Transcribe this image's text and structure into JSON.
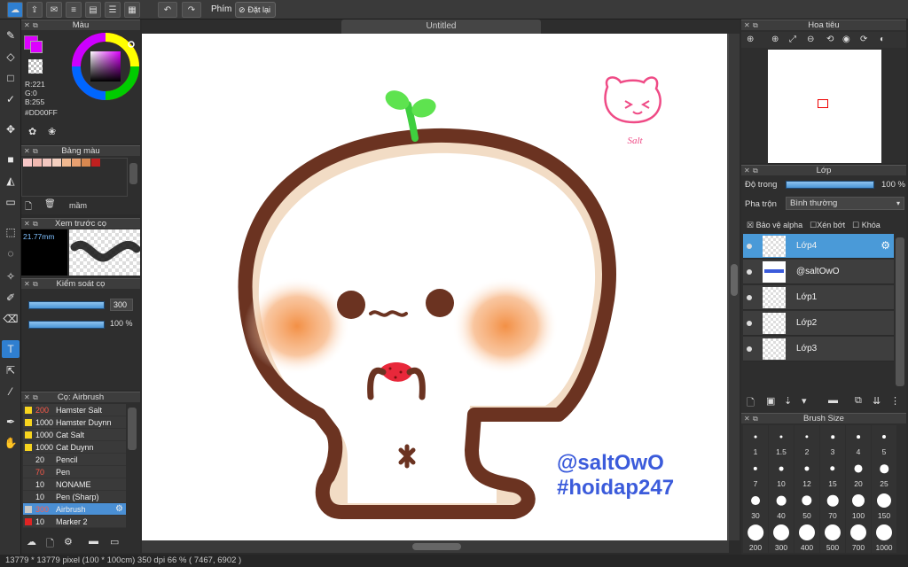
{
  "toolbar": {
    "shortcuts_label": "Phím",
    "reset_label": "Đặt lại"
  },
  "document": {
    "tab_title": "Untitled"
  },
  "color_panel": {
    "title": "Màu",
    "r": "R:221",
    "g": "G:0",
    "b": "B:255",
    "hex": "#DD00FF",
    "main_color": "#DD00FF"
  },
  "palette_panel": {
    "title": "Bảng màu",
    "swatches": [
      "#f6c6c6",
      "#f0b8b0",
      "#f3c7c0",
      "#f5d0c0",
      "#f0b890",
      "#e9a070",
      "#d98850",
      "#c0201f"
    ],
    "name_label": "mầm"
  },
  "preview_panel": {
    "title": "Xem trước cọ",
    "size_readout": "21.77mm"
  },
  "brush_control_panel": {
    "title": "Kiểm soát cọ",
    "size_value": "300",
    "opacity_value": "100 %"
  },
  "brush_list_panel": {
    "title": "Cọ: Airbrush",
    "items": [
      {
        "size": "200",
        "name": "Hamster Salt",
        "color": "#f7d41e",
        "size_red": true
      },
      {
        "size": "1000",
        "name": "Hamster Duynn",
        "color": "#f7d41e",
        "size_red": false
      },
      {
        "size": "1000",
        "name": "Cat Salt",
        "color": "#f7d41e",
        "size_red": false
      },
      {
        "size": "1000",
        "name": "Cat Duynn",
        "color": "#f7d41e",
        "size_red": false
      },
      {
        "size": "20",
        "name": "Pencil",
        "color": "#3a3a3a",
        "size_red": false
      },
      {
        "size": "70",
        "name": "Pen",
        "color": "#3a3a3a",
        "size_red": true
      },
      {
        "size": "10",
        "name": "NONAME",
        "color": "#3a3a3a",
        "size_red": false
      },
      {
        "size": "10",
        "name": "Pen (Sharp)",
        "color": "#3a3a3a",
        "size_red": false
      },
      {
        "size": "300",
        "name": "Airbrush",
        "color": "#c8c8c8",
        "size_red": true
      },
      {
        "size": "10",
        "name": "Marker 2",
        "color": "#e02424",
        "size_red": false
      }
    ]
  },
  "navigator_panel": {
    "title": "Hoa tiêu"
  },
  "layer_panel": {
    "title": "Lớp",
    "opacity_label": "Độ trong",
    "opacity_value": "100 %",
    "opacity_fraction": 1.0,
    "blend_label": "Pha trộn",
    "blend_value": "Bình thường",
    "protect_alpha": "Bảo vệ alpha",
    "clipping": "Xén bớt",
    "lock": "Khóa",
    "layers": [
      {
        "name": "Lớp4",
        "selected": true
      },
      {
        "name": "@saltOwO",
        "selected": false
      },
      {
        "name": "Lớp1",
        "selected": false
      },
      {
        "name": "Lớp2",
        "selected": false
      },
      {
        "name": "Lớp3",
        "selected": false
      }
    ]
  },
  "brush_size_panel": {
    "title": "Brush Size",
    "sizes": [
      "1",
      "1.5",
      "2",
      "3",
      "4",
      "5",
      "7",
      "10",
      "12",
      "15",
      "20",
      "25",
      "30",
      "40",
      "50",
      "70",
      "100",
      "150",
      "200",
      "300",
      "400",
      "500",
      "700",
      "1000"
    ]
  },
  "artwork": {
    "text_line1": "@saltOwO",
    "text_line2": "#hoidap247",
    "text_color": "#3b5bdb",
    "signature": "Salt"
  },
  "status": {
    "text": "13779 * 13779 pixel  (100 * 100cm)  350 dpi  66 %  ( 7467, 6902 )"
  }
}
